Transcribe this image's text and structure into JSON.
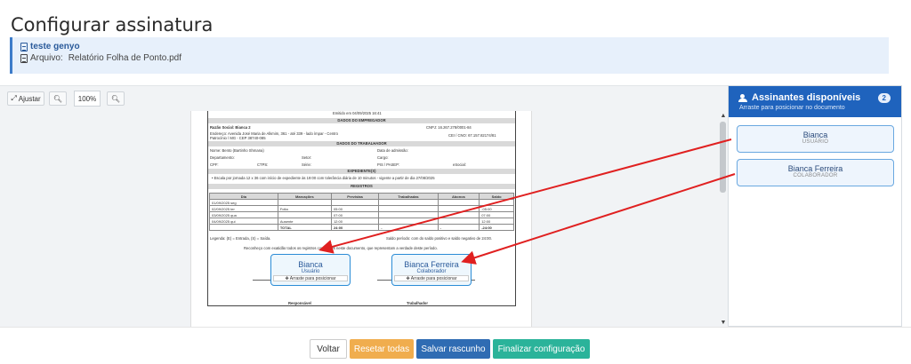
{
  "page_title": "Configurar assinatura",
  "info": {
    "doc_name": "teste genyo",
    "file_label": "Arquivo:",
    "file_name": "Relatório Folha de Ponto.pdf"
  },
  "toolbar": {
    "fit_label": "Ajustar",
    "zoom_value": "100%"
  },
  "document": {
    "emitted": "Emitido em 04/09/2025 16:41",
    "employer_header": "DADOS DO EMPREGADOR",
    "razao": "Razão Social: Bianca 2",
    "cnpj": "CNPJ: 16.267.278/0001-84",
    "endereco": "Endereço: Avenida José Maria de Alkmim, 361 - até 339 - lado ímpar - Centro",
    "endereco2": "Patrocínio / MG - CEP 38740-085",
    "cei": "CEI / CNO: 67.157.82174/81",
    "worker_header": "DADOS DO TRABALHADOR",
    "nome": "Nome: Bento (Bartinho Shmana)",
    "admissao": "Data de admissão:",
    "departamento": "Departamento:",
    "setor": "Setor:",
    "cargo": "Cargo:",
    "cpf": "CPF:",
    "ctps": "CTPS:",
    "serie": "Série:",
    "pis": "PIS / PASEP:",
    "esocial": "eSocial:",
    "expediente_header": "EXPEDIENTE(S)",
    "expediente_line": "• Escala por jornada 12 x 36 com início de expediente às 19:00 com tolerância diária de 10 minutos - vigente a partir de dia 27/08/2025",
    "registros_header": "REGISTROS",
    "table_headers": [
      "Dia",
      "Marcações",
      "Previstas",
      "Trabalhadas",
      "Abonos",
      "Saldo"
    ],
    "table_rows": [
      [
        "01/09/2025 seg",
        "",
        "",
        "",
        "",
        ""
      ],
      [
        "02/09/2025 ter",
        "Folta",
        "05:00",
        "",
        "",
        "-05:00"
      ],
      [
        "03/09/2025 qua",
        "",
        "07:00",
        "",
        "",
        "07:00"
      ],
      [
        "04/09/2025 qui",
        "Ausente",
        "12:00",
        "",
        "",
        "12:00"
      ],
      [
        "",
        "TOTAL",
        "24:00",
        "-",
        "-",
        "-24:00"
      ]
    ],
    "legenda": "Legenda: (E) = Entrada, (S) = Saída.",
    "saldo_note": "Saldo período: com do saldo positivo e saldo negativo de 24:00.",
    "recognition": "Reconheço com exatidão todos os registros constantes neste documento, que representam a verdade deste período.",
    "responsavel": "Responsável",
    "trabalhador": "Trabalhador"
  },
  "placed_signers": [
    {
      "name": "Bianca",
      "role": "Usuário",
      "drag_hint": "Arraste para posicionar"
    },
    {
      "name": "Bianca Ferreira",
      "role": "Colaborador",
      "drag_hint": "Arraste para posicionar"
    }
  ],
  "panel": {
    "title": "Assinantes disponíveis",
    "subtitle": "Arraste para posicionar no documento",
    "count": "2",
    "signers": [
      {
        "name": "Bianca",
        "role": "USUÁRIO"
      },
      {
        "name": "Bianca Ferreira",
        "role": "COLABORADOR"
      }
    ]
  },
  "footer": {
    "back": "Voltar",
    "reset": "Resetar todas",
    "save_draft": "Salvar rascunho",
    "finish": "Finalizar configuração"
  },
  "colors": {
    "primary": "#1f63bd",
    "reset": "#f0ad4e",
    "save": "#2f6cb3",
    "finish": "#2bb39a",
    "arrow": "#e02020"
  }
}
